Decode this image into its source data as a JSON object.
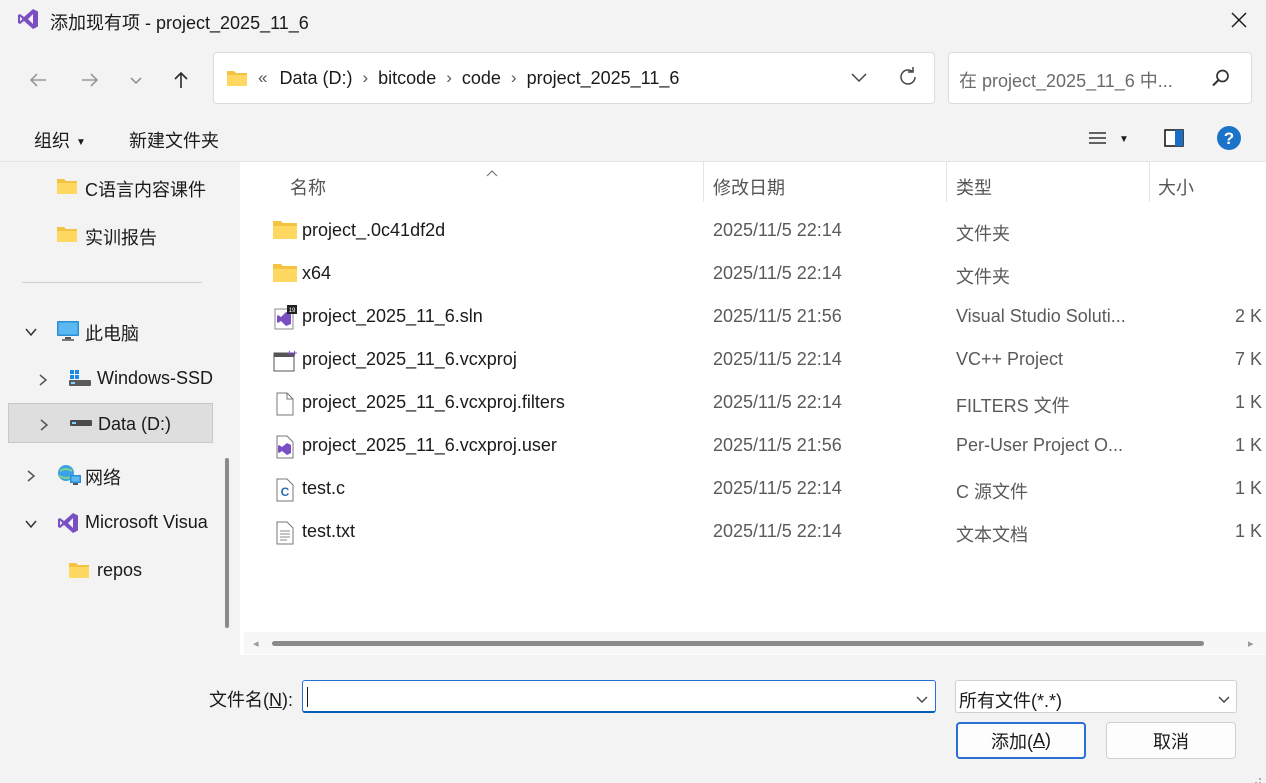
{
  "window": {
    "title": "添加现有项 - project_2025_11_6"
  },
  "nav": {
    "breadcrumb_lead": "«",
    "breadcrumbs": [
      "Data (D:)",
      "bitcode",
      "code",
      "project_2025_11_6"
    ],
    "search_placeholder": "在 project_2025_11_6 中..."
  },
  "toolbar": {
    "organize_label": "组织",
    "new_folder_label": "新建文件夹"
  },
  "sidebar": {
    "items": [
      {
        "label": "C语言内容课件",
        "icon": "folder-icon"
      },
      {
        "label": "实训报告",
        "icon": "folder-icon"
      },
      {
        "label": "此电脑",
        "icon": "computer-icon",
        "expanded": true
      },
      {
        "label": "Windows-SSD",
        "icon": "drive-icon",
        "expanded": false
      },
      {
        "label": "Data (D:)",
        "icon": "drive-icon",
        "expanded": false,
        "selected": true
      },
      {
        "label": "网络",
        "icon": "network-icon",
        "expanded": false
      },
      {
        "label": "Microsoft Visua",
        "icon": "visual-studio-icon",
        "expanded": true
      },
      {
        "label": "repos",
        "icon": "folder-icon"
      }
    ]
  },
  "columns": {
    "name": "名称",
    "modified": "修改日期",
    "type": "类型",
    "size": "大小"
  },
  "files": [
    {
      "name": "project_.0c41df2d",
      "modified": "2025/11/5 22:14",
      "type": "文件夹",
      "size": "",
      "icon": "folder-icon"
    },
    {
      "name": "x64",
      "modified": "2025/11/5 22:14",
      "type": "文件夹",
      "size": "",
      "icon": "folder-icon"
    },
    {
      "name": "project_2025_11_6.sln",
      "modified": "2025/11/5 21:56",
      "type": "Visual Studio Soluti...",
      "size": "2 K",
      "icon": "solution-file-icon"
    },
    {
      "name": "project_2025_11_6.vcxproj",
      "modified": "2025/11/5 22:14",
      "type": "VC++ Project",
      "size": "7 K",
      "icon": "vcxproj-file-icon"
    },
    {
      "name": "project_2025_11_6.vcxproj.filters",
      "modified": "2025/11/5 22:14",
      "type": "FILTERS 文件",
      "size": "1 K",
      "icon": "blank-file-icon"
    },
    {
      "name": "project_2025_11_6.vcxproj.user",
      "modified": "2025/11/5 21:56",
      "type": "Per-User Project O...",
      "size": "1 K",
      "icon": "user-file-icon"
    },
    {
      "name": "test.c",
      "modified": "2025/11/5 22:14",
      "type": "C 源文件",
      "size": "1 K",
      "icon": "c-source-file-icon"
    },
    {
      "name": "test.txt",
      "modified": "2025/11/5 22:14",
      "type": "文本文档",
      "size": "1 K",
      "icon": "text-file-icon"
    }
  ],
  "footer": {
    "filename_label_prefix": "文件名(",
    "filename_label_key": "N",
    "filename_label_suffix": "):",
    "filename_value": "",
    "filetype_value": "所有文件(*.*)",
    "add_prefix": "添加(",
    "add_key": "A",
    "add_suffix": ")",
    "cancel_label": "取消"
  },
  "colors": {
    "accent": "#005fb8",
    "folder": "#f5c342",
    "help": "#1a73c9",
    "vs_purple": "#7a4fc4"
  }
}
